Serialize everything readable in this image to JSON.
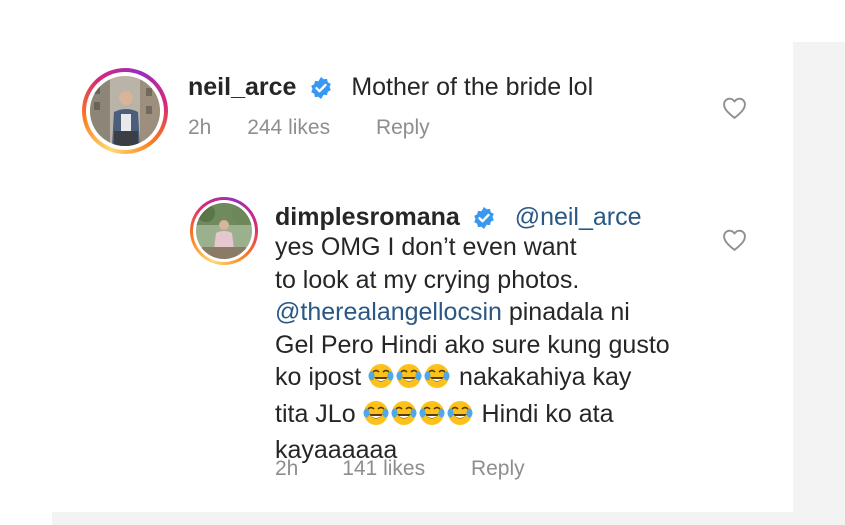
{
  "comment": {
    "username": "neil_arce",
    "text": "Mother of the bride lol",
    "time": "2h",
    "likes": "244 likes",
    "reply_label": "Reply"
  },
  "reply": {
    "username": "dimplesromana",
    "mention": "@neil_arce",
    "lines": {
      "l1": "yes OMG I don’t even want",
      "l2": "to look at my crying photos.",
      "l3_mention": "@therealangellocsin",
      "l3_rest": " pinadala ni",
      "l4": "Gel Pero Hindi ako sure kung gusto",
      "l5_a": "ko ipost ",
      "l5_b": " nakakahiya kay",
      "l6_a": "tita JLo ",
      "l6_b": " Hindi ko ata",
      "l7": "kayaaaaaa"
    },
    "time": "2h",
    "likes": "141 likes",
    "reply_label": "Reply"
  },
  "icons": {
    "verified": "verified-badge-icon",
    "like": "heart-icon",
    "emoji": "face-with-tears-of-joy-icon"
  },
  "colors": {
    "text": "#262626",
    "muted": "#8e8e8e",
    "mention": "#2a5885",
    "verified": "#3897f0"
  }
}
